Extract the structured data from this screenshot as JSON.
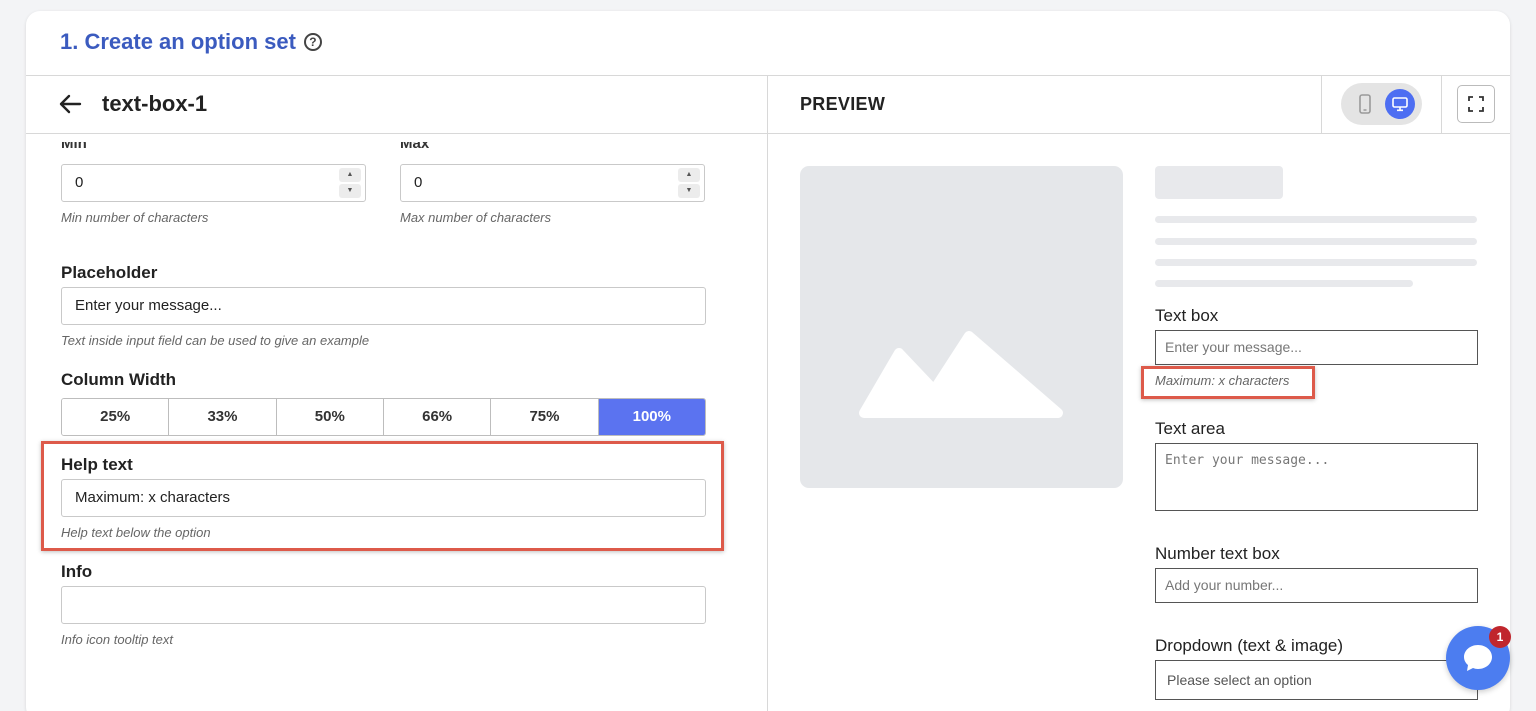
{
  "header": {
    "title": "1. Create an option set",
    "help_icon": "question-circle-icon"
  },
  "editor": {
    "name": "text-box-1"
  },
  "preview": {
    "label": "PREVIEW"
  },
  "form": {
    "min": {
      "label": "Min",
      "value": "0",
      "hint": "Min number of characters"
    },
    "max": {
      "label": "Max",
      "value": "0",
      "hint": "Max number of characters"
    },
    "placeholder": {
      "label": "Placeholder",
      "value": "Enter your message...",
      "hint": "Text inside input field can be used to give an example"
    },
    "column_width": {
      "label": "Column Width",
      "options": [
        "25%",
        "33%",
        "50%",
        "66%",
        "75%",
        "100%"
      ],
      "selected": "100%"
    },
    "help_text": {
      "label": "Help text",
      "value": "Maximum: x characters",
      "hint": "Help text below the option"
    },
    "info": {
      "label": "Info",
      "value": "",
      "hint": "Info icon tooltip text"
    }
  },
  "preview_form": {
    "text_box": {
      "label": "Text box",
      "placeholder": "Enter your message...",
      "help": "Maximum: x characters"
    },
    "text_area": {
      "label": "Text area",
      "placeholder": "Enter your message..."
    },
    "number_box": {
      "label": "Number text box",
      "placeholder": "Add your number..."
    },
    "dropdown": {
      "label": "Dropdown (text & image)",
      "placeholder": "Please select an option"
    }
  },
  "chat": {
    "badge": "1"
  },
  "colors": {
    "accent": "#5b73f0",
    "title": "#3b5bbf",
    "highlight": "#dd5a4a",
    "badge": "#c0262d"
  }
}
